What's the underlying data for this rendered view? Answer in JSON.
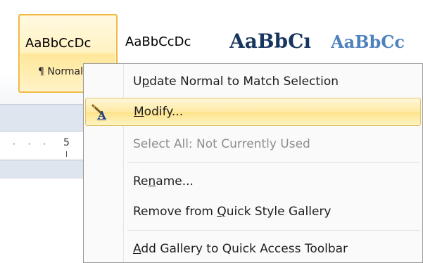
{
  "styles_gallery": {
    "tiles": [
      {
        "sample": "AaBbCcDc",
        "caption": "¶ Normal"
      },
      {
        "sample": "AaBbCcDc"
      },
      {
        "sample": "AaBbCı"
      },
      {
        "sample": "AaBbCc"
      }
    ]
  },
  "ruler": {
    "number": "5",
    "dots": "· · ·"
  },
  "context_menu": {
    "items": [
      {
        "pre": "U",
        "accel": "p",
        "post": "date Normal to Match Selection",
        "state": "normal"
      },
      {
        "pre": "",
        "accel": "M",
        "post": "odify...",
        "state": "hovered",
        "icon": "modify-style-icon"
      },
      {
        "pre": "Select All: Not Currently Used",
        "accel": "",
        "post": "",
        "state": "disabled"
      },
      {
        "pre": "Re",
        "accel": "n",
        "post": "ame...",
        "state": "normal"
      },
      {
        "pre": "Remove from ",
        "accel": "Q",
        "post": "uick Style Gallery",
        "state": "normal"
      },
      {
        "pre": "",
        "accel": "A",
        "post": "dd Gallery to Quick Access Toolbar",
        "state": "normal"
      }
    ]
  },
  "colors": {
    "hover_highlight": "#fde38a",
    "selected_tile_border": "#f0b93f",
    "heading1_text": "#17365d",
    "heading2_text": "#4f81bd"
  }
}
